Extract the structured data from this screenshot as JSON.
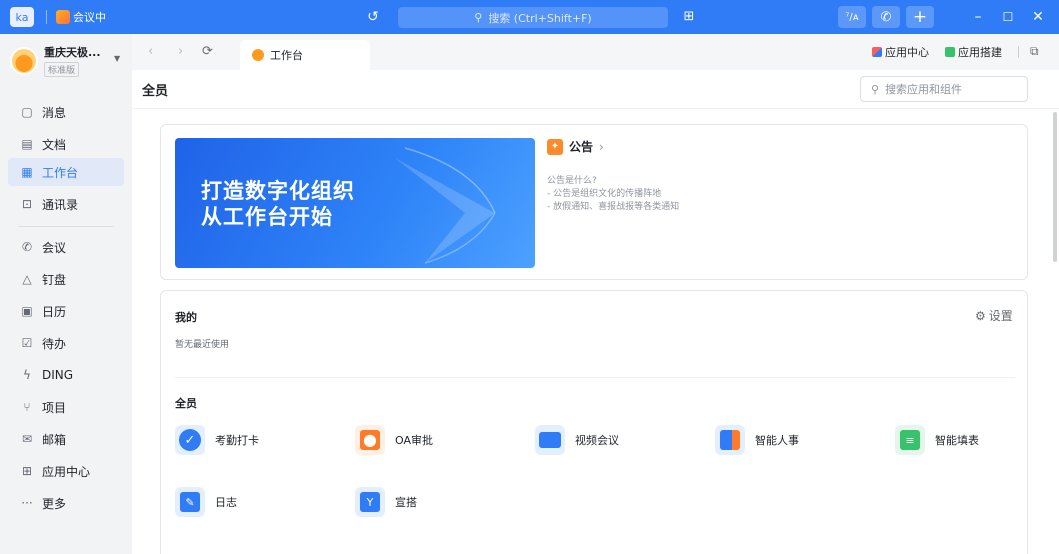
{
  "titlebar": {
    "user_initials": "ka",
    "meeting_label": "会议中",
    "search_placeholder": "搜索 (Ctrl+Shift+F)",
    "ai_label": "⁷/ᴀ"
  },
  "sidebar": {
    "org_name": "重庆天极...",
    "org_edition": "标准版",
    "items": [
      {
        "label": "消息",
        "icon": "chat-icon"
      },
      {
        "label": "文档",
        "icon": "document-icon"
      },
      {
        "label": "工作台",
        "icon": "grid-icon"
      },
      {
        "label": "通讯录",
        "icon": "contacts-icon"
      },
      {
        "label": "会议",
        "icon": "phone-icon"
      },
      {
        "label": "钉盘",
        "icon": "cloud-icon"
      },
      {
        "label": "日历",
        "icon": "calendar-icon"
      },
      {
        "label": "待办",
        "icon": "todo-icon"
      },
      {
        "label": "DING",
        "icon": "ding-icon"
      },
      {
        "label": "项目",
        "icon": "project-icon"
      },
      {
        "label": "邮箱",
        "icon": "mail-icon"
      },
      {
        "label": "应用中心",
        "icon": "apps-icon"
      },
      {
        "label": "更多",
        "icon": "more-icon"
      }
    ]
  },
  "tabbar": {
    "active_tab": "工作台",
    "app_center": "应用中心",
    "app_builder": "应用搭建"
  },
  "page": {
    "title": "全员",
    "search_placeholder": "搜索应用和组件"
  },
  "banner": {
    "line1": "打造数字化组织",
    "line2": "从工作台开始"
  },
  "announcement": {
    "title": "公告",
    "lines": [
      "公告是什么?",
      "- 公告是组织文化的传播阵地",
      "- 放假通知、喜报战报等各类通知"
    ]
  },
  "mine": {
    "title": "我的",
    "settings_label": "设置",
    "empty_text": "暂无最近使用"
  },
  "all_apps": {
    "title": "全员",
    "apps": [
      {
        "label": "考勤打卡",
        "color": "#2f7cf6",
        "bg": "#e3eeff"
      },
      {
        "label": "OA审批",
        "color": "#ff7a2b",
        "bg": "#fff0e3"
      },
      {
        "label": "视频会议",
        "color": "#2f7cf6",
        "bg": "#e3eeff"
      },
      {
        "label": "智能人事",
        "color": "#2f7cf6",
        "bg": "#e3eeff"
      },
      {
        "label": "智能填表",
        "color": "#38c26b",
        "bg": "#e4f7ea"
      },
      {
        "label": "日志",
        "color": "#2f7cf6",
        "bg": "#e3eeff"
      },
      {
        "label": "宣搭",
        "color": "#2f7cf6",
        "bg": "#e3eeff"
      }
    ]
  }
}
